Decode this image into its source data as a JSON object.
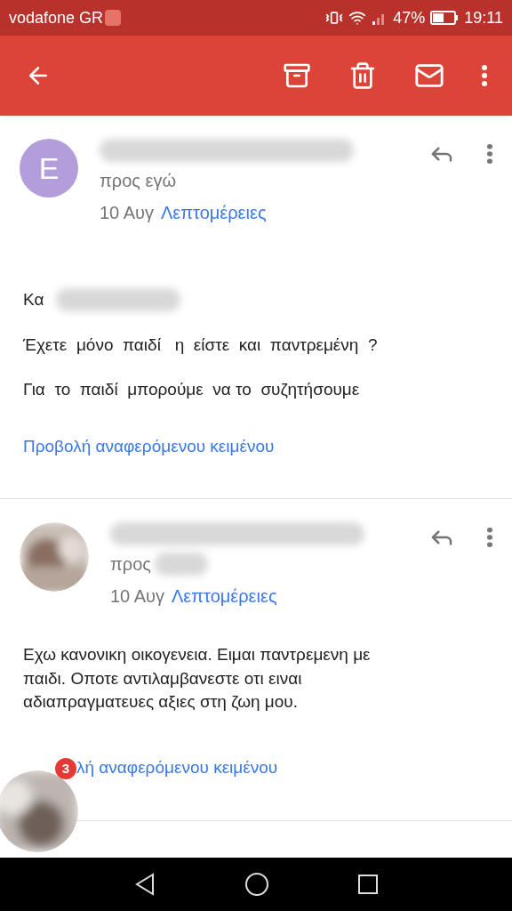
{
  "status_bar": {
    "carrier": "vodafone GR",
    "battery": "47%",
    "time": "19:11"
  },
  "messages": [
    {
      "avatar": {
        "kind": "letter",
        "letter": "E",
        "color": "#b39ddb"
      },
      "to": "προς εγώ",
      "date": "10 Αυγ",
      "details": "Λεπτομέρειες",
      "body": [
        "Κα",
        "Έχετε  μόνο  παιδί   η  είστε  και  παντρεμένη  ?",
        "Για  το  παιδί  μπορούμε  να το  συζητήσουμε"
      ],
      "quoted": "Προβολή αναφερόμενου κειμένου"
    },
    {
      "avatar": {
        "kind": "picture"
      },
      "to": "προς",
      "date": "10 Αυγ",
      "details": "Λεπτομέρειες",
      "body": [
        "Εχω κανονικη οικογενεια. Ειμαι παντρεμενη με παιδι. Οποτε αντιλαμβανεστε οτι ειναι αδιαπραγματευες αξιες στη ζωη μου."
      ],
      "quoted": "λή αναφερόμενου κειμένου"
    }
  ],
  "chat_head": {
    "badge": "3"
  }
}
